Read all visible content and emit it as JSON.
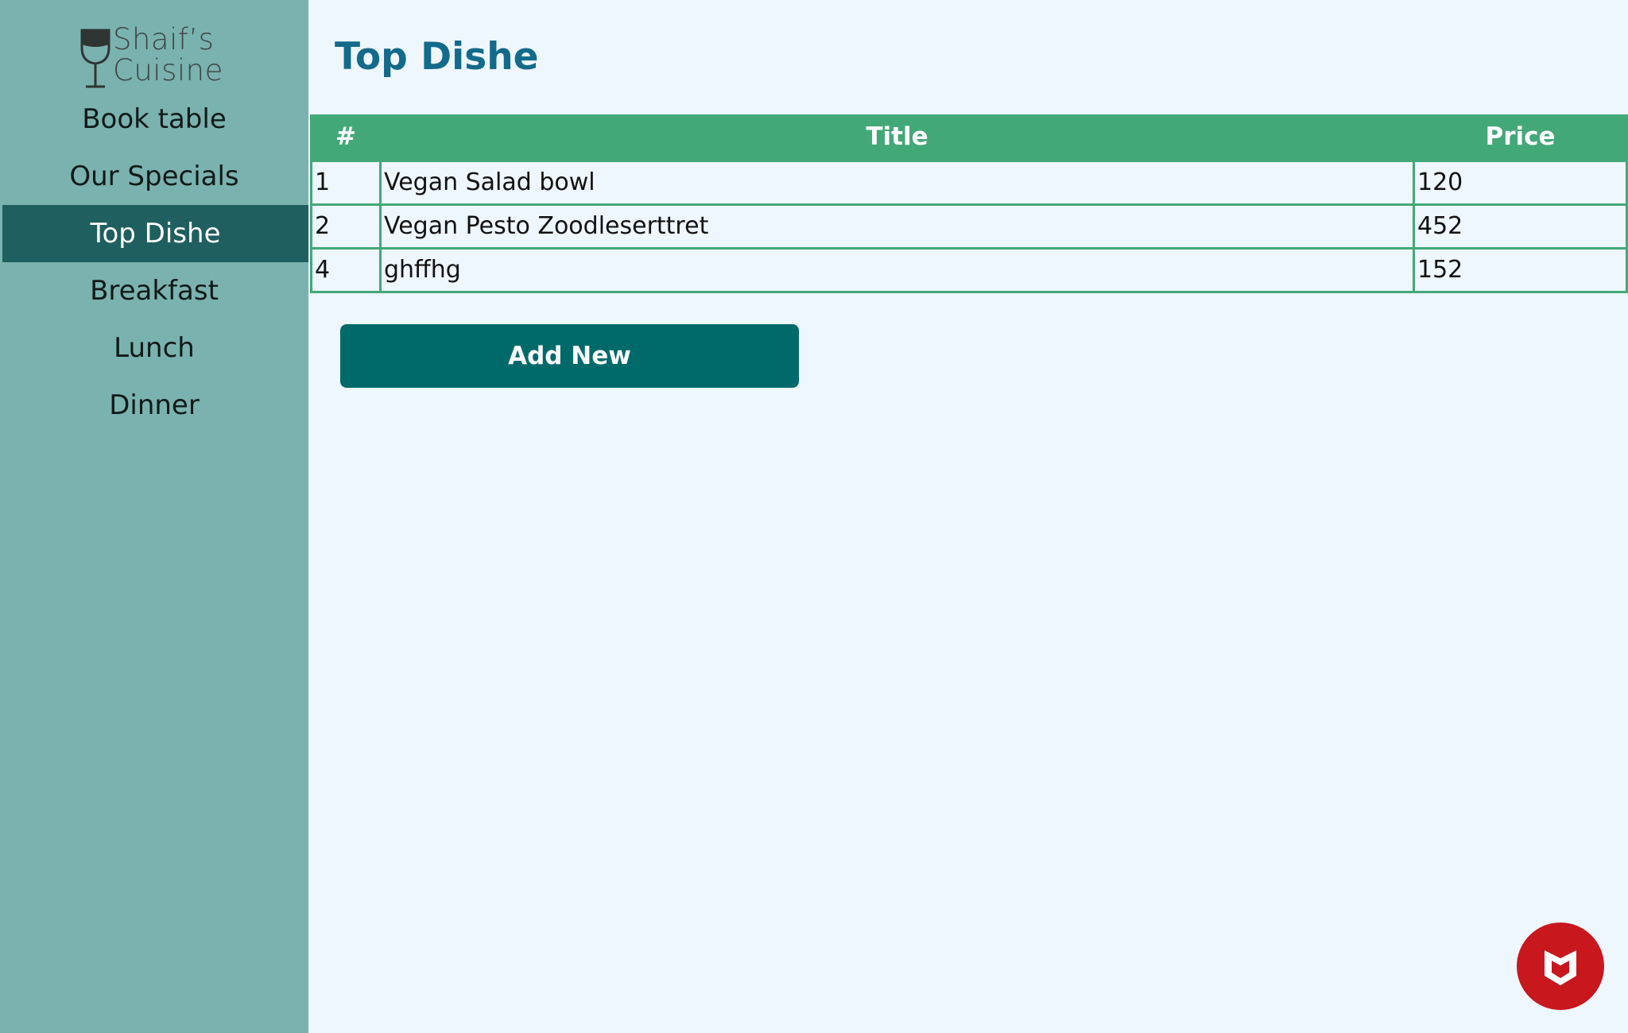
{
  "sidebar": {
    "brand_line1": "Shaif’s",
    "brand_line2": "Cuisine",
    "items": [
      {
        "label": "Book table"
      },
      {
        "label": "Our Specials"
      },
      {
        "label": "Top Dishe"
      },
      {
        "label": "Breakfast"
      },
      {
        "label": "Lunch"
      },
      {
        "label": "Dinner"
      }
    ],
    "active_index": 2
  },
  "main": {
    "title": "Top Dishe",
    "table": {
      "headers": [
        "#",
        "Title",
        "Price"
      ],
      "rows": [
        [
          "1",
          "Vegan Salad bowl",
          "120"
        ],
        [
          "2",
          "Vegan Pesto Zoodleserttret",
          "452"
        ],
        [
          "4",
          "ghffhg",
          "152"
        ]
      ]
    },
    "add_button_label": "Add New"
  },
  "tray": {
    "icon": "mcafee-shield-icon"
  },
  "colors": {
    "sidebar_bg": "#7ab2af",
    "active_nav_bg": "#1f5f5f",
    "table_header_bg": "#43a878",
    "button_bg": "#006a6a",
    "title_color": "#136a8a",
    "page_bg": "#eef6fe"
  }
}
